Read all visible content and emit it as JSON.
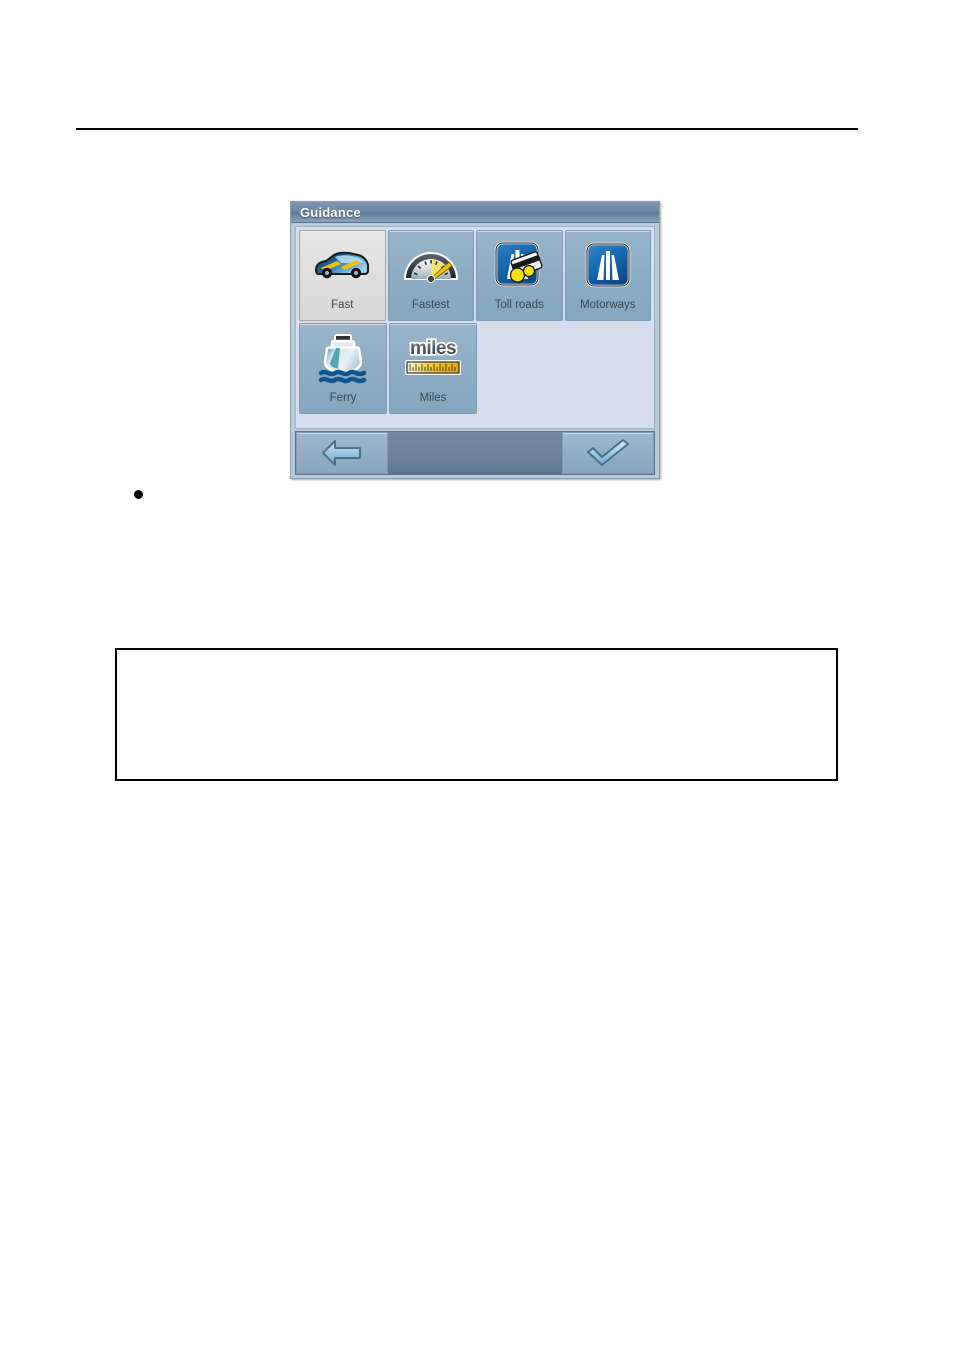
{
  "page": {
    "rule_present": true,
    "bullet_text": "",
    "note_box_text": ""
  },
  "dialog": {
    "title": "Guidance",
    "colors": {
      "titlebar": "#6c88a6",
      "panel_bg": "#d6dded",
      "tile_bg": "#8dacc3",
      "tile_selected_bg": "#e0e0e0",
      "toolbar_bg": "#6b8298",
      "frame": "#b9c9d8",
      "accent_yellow": "#f2d300",
      "accent_blue": "#1668b8"
    },
    "tiles": [
      {
        "label": "Fast",
        "icon": "car-icon",
        "selected": true,
        "row": 1
      },
      {
        "label": "Fastest",
        "icon": "speedometer-icon",
        "selected": false,
        "row": 1
      },
      {
        "label": "Toll roads",
        "icon": "toll-road-icon",
        "selected": false,
        "row": 1
      },
      {
        "label": "Motorways",
        "icon": "motorway-icon",
        "selected": false,
        "row": 1
      },
      {
        "label": "Ferry",
        "icon": "ferry-icon",
        "selected": false,
        "row": 2
      },
      {
        "label": "Miles",
        "icon": "miles-ruler-icon",
        "selected": false,
        "row": 2
      }
    ],
    "toolbar": {
      "back_label": "",
      "back_icon": "back-arrow-icon",
      "confirm_label": "",
      "confirm_icon": "checkmark-icon"
    }
  }
}
